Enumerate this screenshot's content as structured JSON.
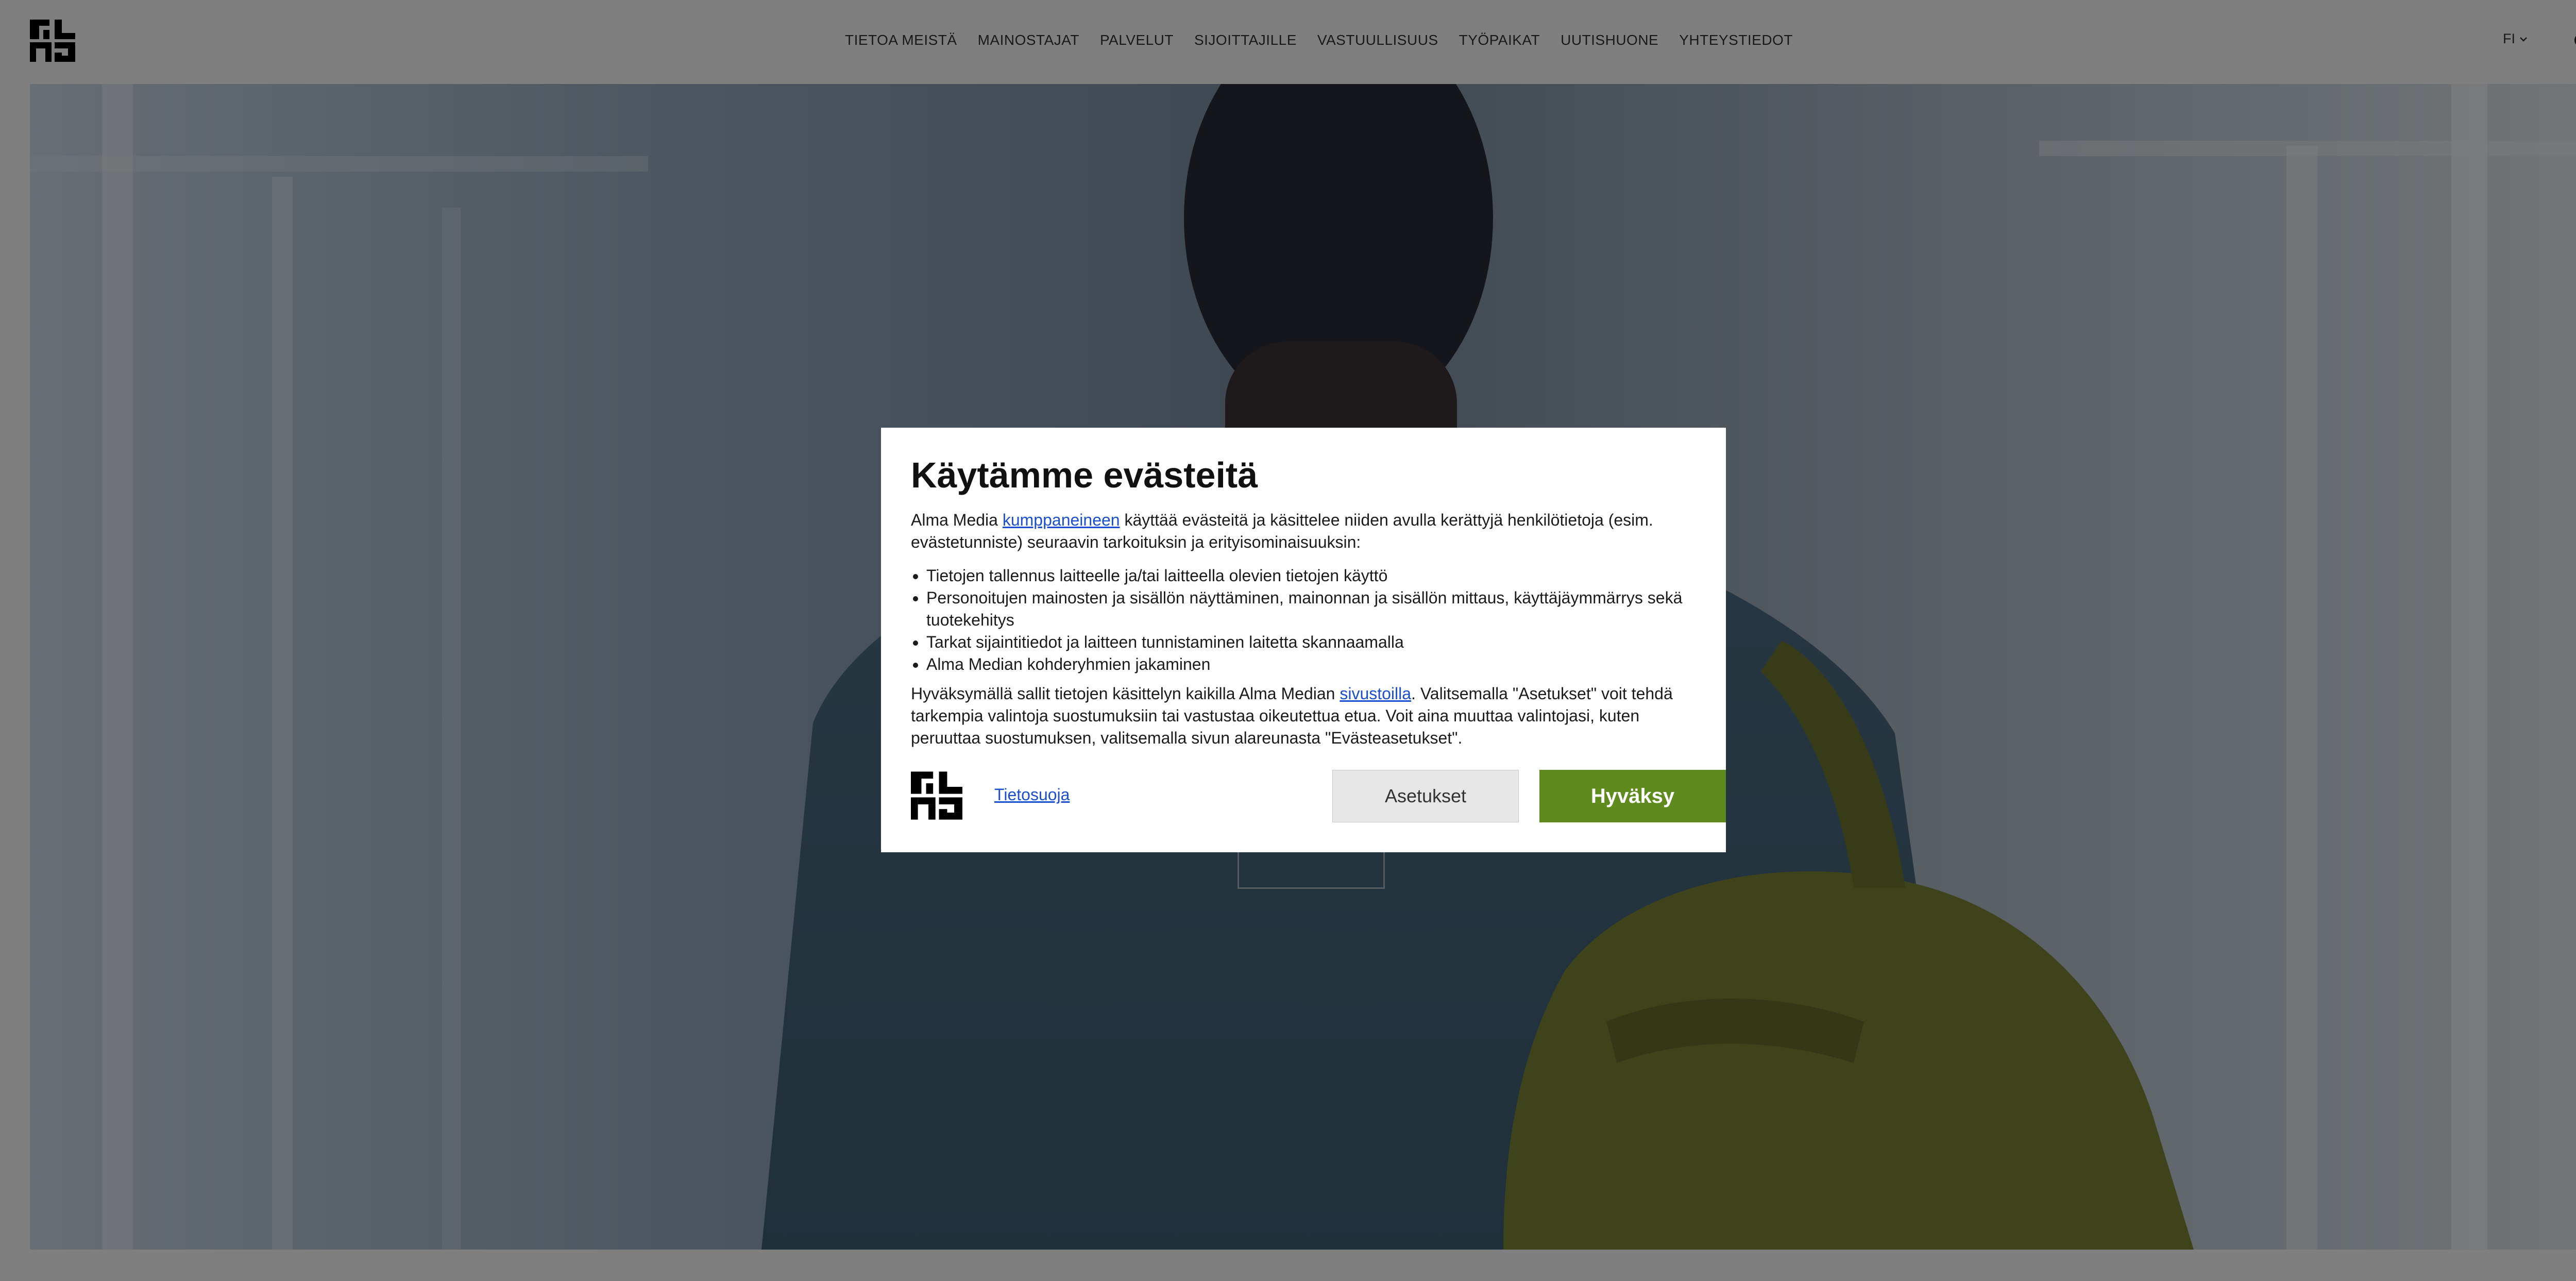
{
  "header": {
    "logo": "alma-logo",
    "nav": [
      "TIETOA MEISTÄ",
      "MAINOSTAJAT",
      "PALVELUT",
      "SIJOITTAJILLE",
      "VASTUULLISUUS",
      "TYÖPAIKAT",
      "UUTISHUONE",
      "YHTEYSTIEDOT"
    ],
    "lang": "FI",
    "lang_icon": "chevron-down-icon",
    "search_icon": "search-icon"
  },
  "cookie_modal": {
    "title": "Käytämme evästeitä",
    "intro_before": "Alma Media ",
    "intro_link": "kumppaneineen",
    "intro_after": " käyttää evästeitä ja käsittelee niiden avulla kerättyjä henkilötietoja (esim. evästetunniste) seuraavin tarkoituksin ja erityisominaisuuksin:",
    "purposes": [
      "Tietojen tallennus laitteelle ja/tai laitteella olevien tietojen käyttö",
      "Personoitujen mainosten ja sisällön näyttäminen, mainonnan ja sisällön mittaus, käyttäjäymmärrys sekä tuotekehitys",
      "Tarkat sijaintitiedot ja laitteen tunnistaminen laitetta skannaamalla",
      "Alma Median kohderyhmien jakaminen"
    ],
    "consent_before": "Hyväksymällä sallit tietojen käsittelyn kaikilla Alma Median ",
    "consent_link": "sivustoilla",
    "consent_after": ". Valitsemalla \"Asetukset\" voit tehdä tarkempia valintoja suostumuksiin tai vastustaa oikeutettua etua. Voit aina muuttaa valintojasi, kuten peruuttaa suostumuksen, valitsemalla sivun alareunasta \"Evästeasetukset\".",
    "privacy_link": "Tietosuoja",
    "settings_button": "Asetukset",
    "accept_button": "Hyväksy"
  },
  "colors": {
    "accept": "#5f8a1e",
    "link": "#1a4fd1",
    "overlay": "rgba(0,0,0,0.5)"
  }
}
